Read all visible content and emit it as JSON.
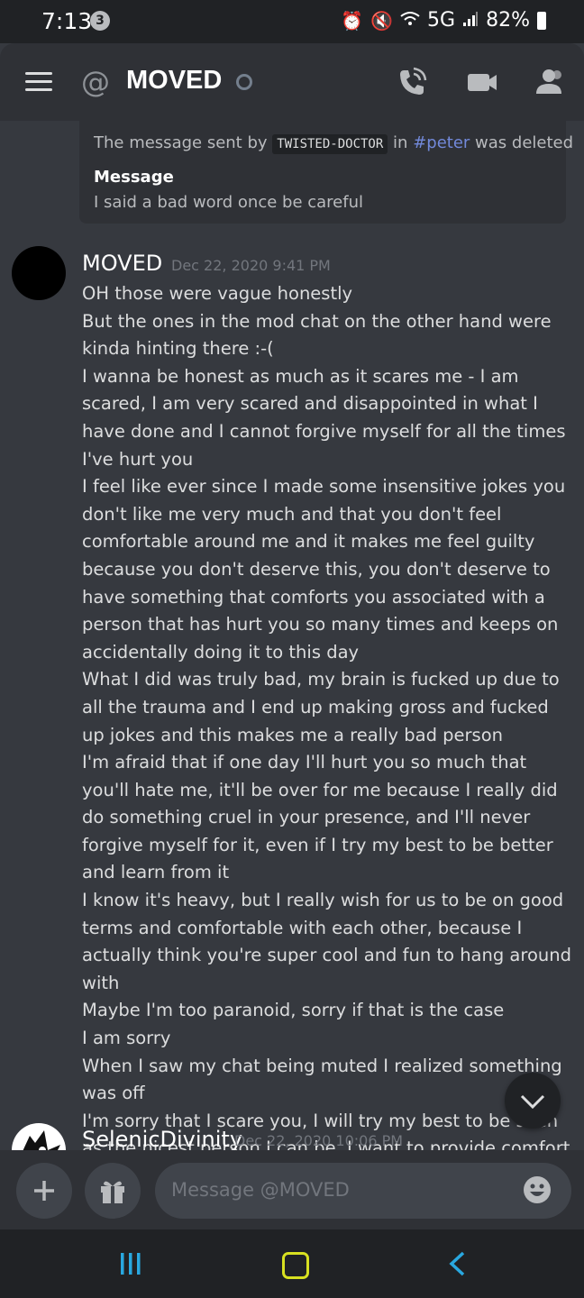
{
  "status_bar": {
    "time": "7:13",
    "notification_count": "3",
    "network": "5G",
    "battery": "82%"
  },
  "header": {
    "title": "MOVED"
  },
  "embed": {
    "text_before": "The message sent by",
    "user": "TWISTED-DOCTOR",
    "text_in": "in",
    "channel": "#peter",
    "text_after": "was deleted",
    "field_label": "Message",
    "field_value": "I said a bad word once be careful"
  },
  "message": {
    "author": "MOVED",
    "timestamp": "Dec 22, 2020 9:41 PM",
    "lines": [
      "OH those were vague honestly",
      "But the ones in the mod chat on the other hand were kinda hinting there :-(",
      "I wanna be honest as much as it scares me - I am scared, I am very scared and disappointed in what I have done and I cannot forgive myself for all the times I've hurt you",
      "I feel like ever since I made some insensitive jokes you don't like me very much and that you don't feel comfortable around me and it makes me feel guilty because you don't deserve this, you don't deserve to have something that comforts you associated with a person that has hurt you so many times and keeps on accidentally doing it to this day",
      "What I did was truly bad, my brain is fucked up due to all the trauma and I end up making gross and fucked up jokes and this makes me a really bad person",
      "I'm afraid that if one day I'll hurt you so much that you'll hate me, it'll be over for me because I really did do something cruel in your presence, and I'll never forgive myself for it, even if I try my best to be better and learn from it",
      "I know it's heavy, but I really wish for us to be on good terms and comfortable with each other, because I actually think you're super cool and fun to hang around with",
      "Maybe I'm too paranoid, sorry if that is the case",
      "I am sorry",
      "When I saw my chat being muted I realized something was off",
      "I'm sorry that I scare you, I will try my best to be seen as the nicest person I can be, I want to provide comfort to a person, I don't want to be scary"
    ]
  },
  "next_message": {
    "author": "SelenicDivinity",
    "timestamp": "Dec 22, 2020 10:06 PM"
  },
  "composer": {
    "placeholder": "Message @MOVED"
  }
}
